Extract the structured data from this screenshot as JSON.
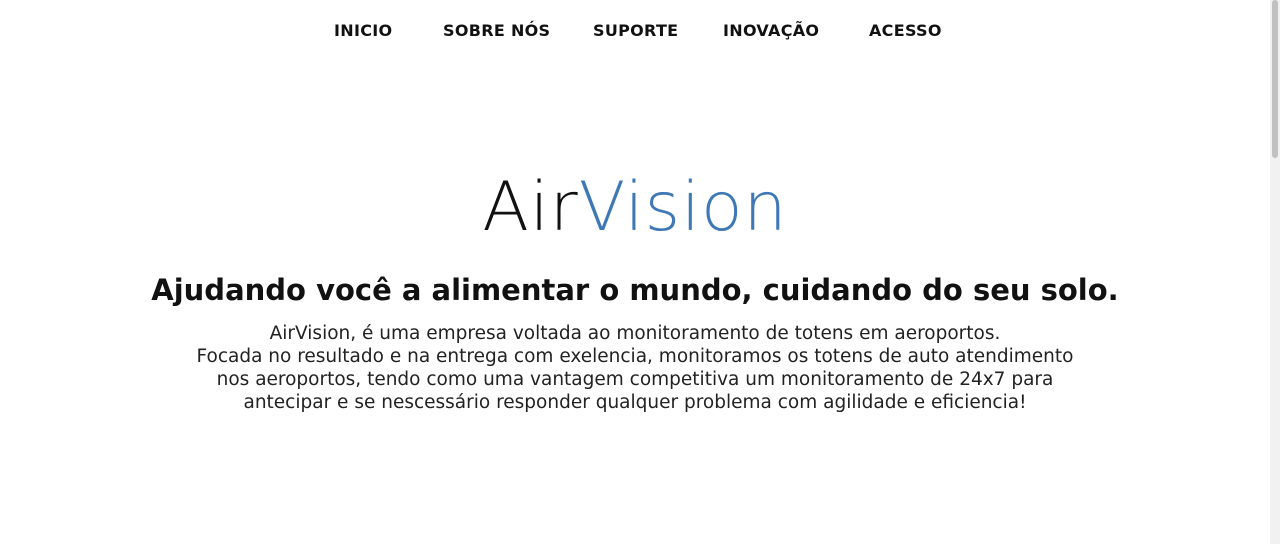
{
  "nav": {
    "items": [
      {
        "label": "INICIO"
      },
      {
        "label": "SOBRE NÓS"
      },
      {
        "label": "SUPORTE"
      },
      {
        "label": "INOVAÇÃO"
      },
      {
        "label": "ACESSO"
      }
    ]
  },
  "hero": {
    "logo_part_a": "Air",
    "logo_part_b": "Vision",
    "tagline": "Ajudando você a alimentar o mundo, cuidando do seu solo.",
    "description_lines": [
      "AirVision, é uma empresa voltada ao monitoramento de totens em aeroportos.",
      "Focada no resultado e na entrega com exelencia, monitoramos os totens de auto atendimento",
      "nos aeroportos, tendo como uma vantagem competitiva um monitoramento de 24x7 para",
      "antecipar e se nescessário responder qualquer problema com agilidade e eficiencia!"
    ]
  },
  "colors": {
    "logo_accent": "#3e78b5",
    "text": "#111111",
    "background": "#ffffff"
  }
}
